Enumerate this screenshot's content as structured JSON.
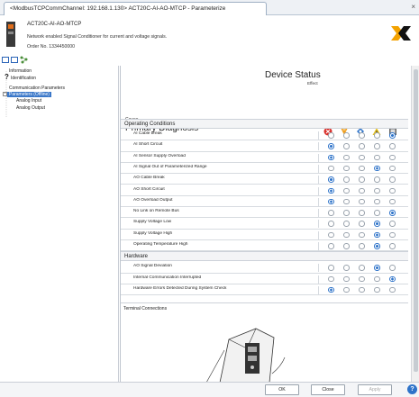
{
  "window": {
    "tab_title": "<ModbusTCPCommChannel: 192.168.1.130> ACT20C-AI-AO-MTCP - Parameterize",
    "close_glyph": "×"
  },
  "device": {
    "name": "ACT20C-AI-AO-MTCP",
    "description": "Network enabled Signal Conditioner for current and voltage signals.",
    "order": "Order No. 1334450000"
  },
  "tree": {
    "items": [
      {
        "label": "Information"
      },
      {
        "label": "Identification"
      },
      {
        "label": "Communication Parameters"
      },
      {
        "label": "Parameters (Offline)"
      },
      {
        "label": "Analog Input"
      },
      {
        "label": "Analog Output"
      }
    ]
  },
  "main": {
    "title": "Device Status",
    "effect": "Effect",
    "cause": "Cause",
    "heading": "Primary Diagnosis",
    "sections": [
      {
        "title": "Operating Conditions",
        "rows": [
          {
            "label": "AI Cable break",
            "selected": 4
          },
          {
            "label": "AI Short Circuit",
            "selected": 0
          },
          {
            "label": "AI Sensor Supply Overload",
            "selected": 0
          },
          {
            "label": "AI Signal Out of Parameterized Range",
            "selected": 3
          },
          {
            "label": "AO Cable Break",
            "selected": 0
          },
          {
            "label": "AO Short Circuit",
            "selected": 0
          },
          {
            "label": "AO Overload Output",
            "selected": 0
          },
          {
            "label": "No Link on Remote Bus",
            "selected": 4
          },
          {
            "label": "Supply Voltage Low",
            "selected": 3
          },
          {
            "label": "Supply Voltage High",
            "selected": 3
          },
          {
            "label": "Operating Temperature High",
            "selected": 3
          }
        ]
      },
      {
        "title": "Hardware",
        "rows": [
          {
            "label": "AO Signal Deviation",
            "selected": 3
          },
          {
            "label": "Internal Communication Interrupted",
            "selected": 4
          },
          {
            "label": "Hardware Errors Detected During System Check",
            "selected": 0
          }
        ]
      }
    ],
    "terminal_label": "Terminal Connections"
  },
  "buttons": {
    "ok": "OK",
    "close": "Close",
    "apply": "Apply",
    "help": "?"
  },
  "colors": {
    "failure": "#d9302b",
    "function_check": "#f0a020",
    "maintenance": "#2e73c9",
    "out_of_spec": "#e8c21c",
    "selection": "#3b78c9"
  }
}
